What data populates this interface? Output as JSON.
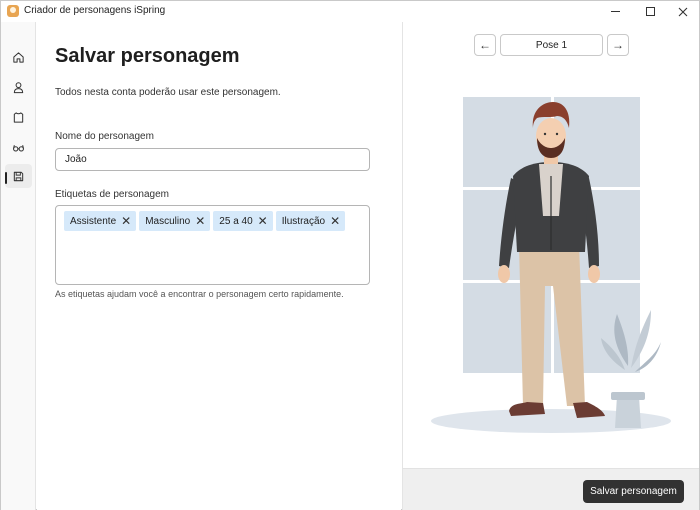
{
  "window": {
    "title": "Criador de personagens iSpring"
  },
  "sidebar": {
    "items": [
      {
        "icon": "home-icon"
      },
      {
        "icon": "user-icon"
      },
      {
        "icon": "shirt-icon"
      },
      {
        "icon": "glasses-icon"
      },
      {
        "icon": "save-icon",
        "active": true
      }
    ]
  },
  "form": {
    "title": "Salvar personagem",
    "subtitle": "Todos nesta conta poderão usar este personagem.",
    "name_label": "Nome do personagem",
    "name_value": "João",
    "tags_label": "Etiquetas de personagem",
    "tags": [
      {
        "label": "Assistente"
      },
      {
        "label": "Masculino"
      },
      {
        "label": "25 a 40"
      },
      {
        "label": "Ilustração"
      }
    ],
    "tag_remove_glyph": "✕",
    "hint": "As etiquetas ajudam você a encontrar o personagem certo rapidamente."
  },
  "preview": {
    "prev_glyph": "←",
    "pose_label": "Pose 1",
    "next_glyph": "→"
  },
  "footer": {
    "save_label": "Salvar personagem"
  },
  "colors": {
    "accent_dark": "#323232",
    "tag_bg": "#d6e9fa",
    "window_panes": "#d4dce4",
    "sweater": "#3f4042",
    "pants": "#dcc3a7",
    "hair": "#8a3f2d",
    "shoes": "#6b3c33"
  }
}
